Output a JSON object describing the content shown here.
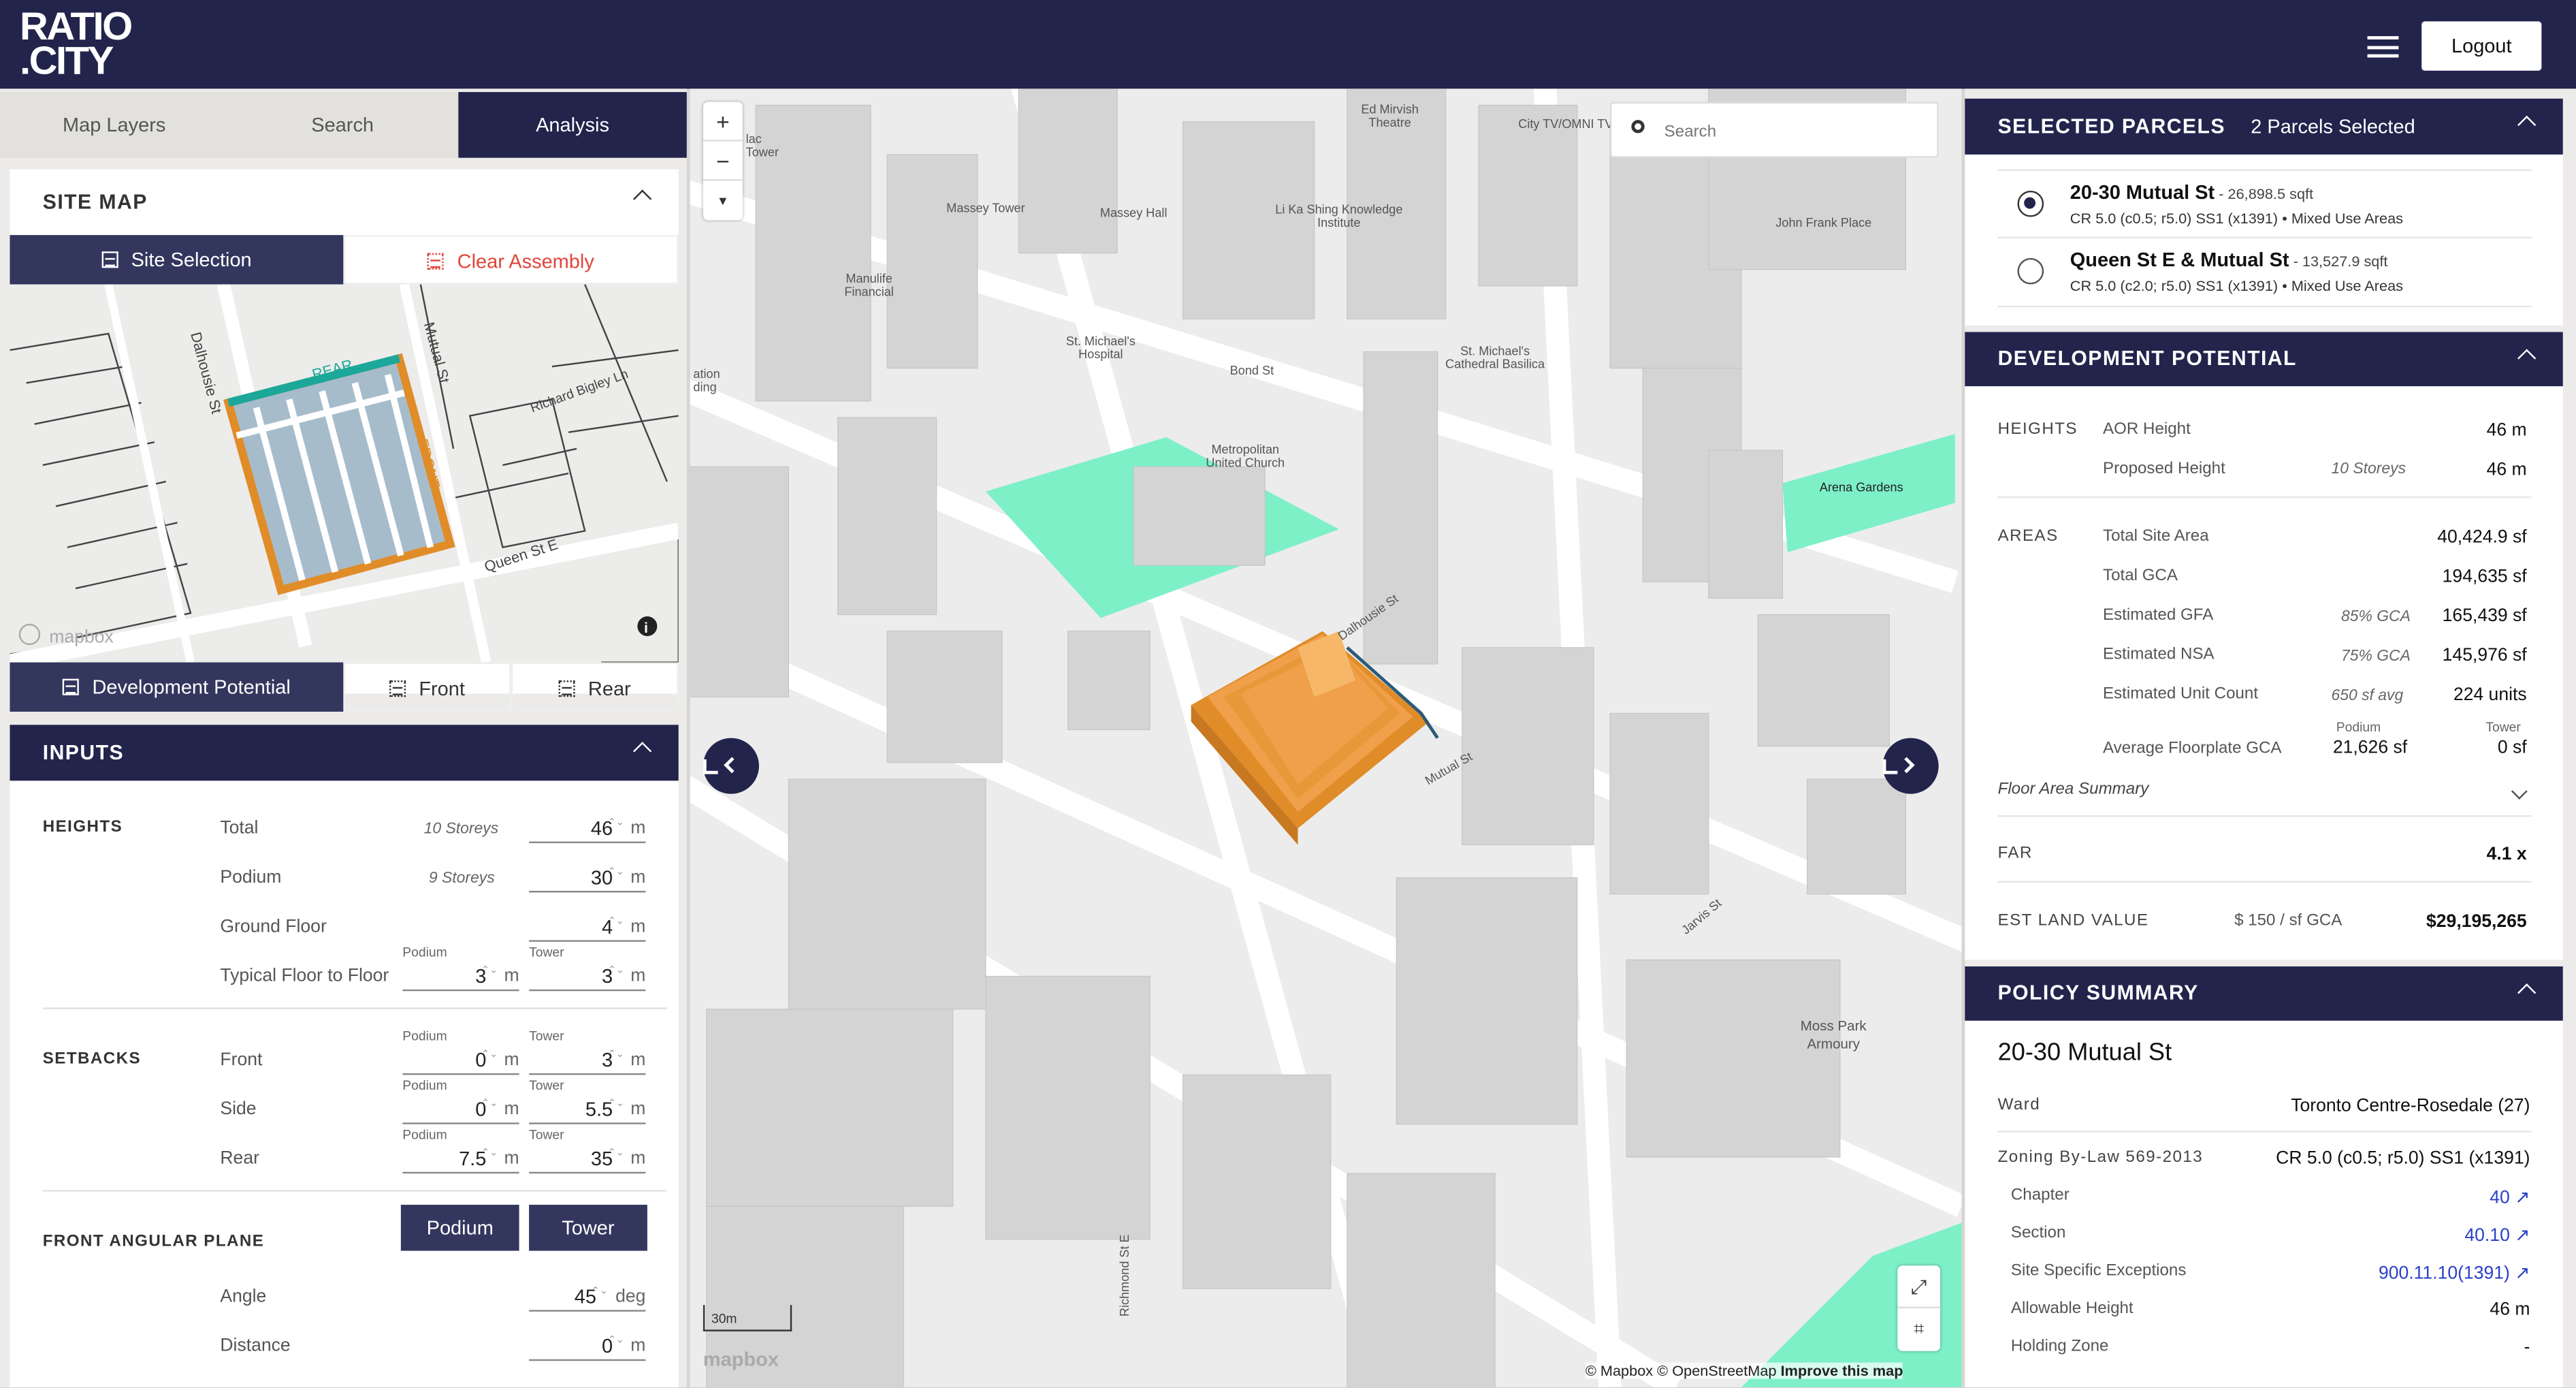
{
  "header": {
    "logo_line1": "RATIO",
    "logo_line2": ".CITY",
    "logout": "Logout",
    "menu_icon": "hamburger-icon"
  },
  "left_tabs": [
    "Map Layers",
    "Search",
    "Analysis"
  ],
  "site_map": {
    "title": "SITE MAP",
    "site_selection": "Site Selection",
    "clear_assembly": "Clear Assembly",
    "labels": {
      "rear": "REAR",
      "front": "FRONT",
      "dalhousie": "Dalhousie St",
      "mutual": "Mutual St",
      "richard": "Richard Bigley Ln",
      "queen": "Queen St E",
      "mapbox": "mapbox"
    },
    "dev_potential": "Development Potential",
    "front": "Front",
    "rear": "Rear"
  },
  "inputs": {
    "title": "INPUTS",
    "heights": {
      "label": "HEIGHTS",
      "total": "Total",
      "total_storeys": "10 Storeys",
      "total_val": "46",
      "podium": "Podium",
      "podium_storeys": "9 Storeys",
      "podium_val": "30",
      "ground": "Ground Floor",
      "ground_val": "4",
      "typical": "Typical Floor to Floor",
      "typ_podium_lbl": "Podium",
      "typ_podium": "3",
      "typ_tower_lbl": "Tower",
      "typ_tower": "3"
    },
    "setbacks": {
      "label": "SETBACKS",
      "front": "Front",
      "side": "Side",
      "rear": "Rear",
      "podium_lbl": "Podium",
      "tower_lbl": "Tower",
      "front_p": "0",
      "front_t": "3",
      "side_p": "0",
      "side_t": "5.5",
      "rear_p": "7.5",
      "rear_t": "35"
    },
    "fap": {
      "label": "FRONT ANGULAR PLANE",
      "podium_btn": "Podium",
      "tower_btn": "Tower",
      "angle": "Angle",
      "angle_val": "45",
      "distance": "Distance",
      "distance_val": "0"
    },
    "unit_m": "m",
    "unit_deg": "deg"
  },
  "map": {
    "search_placeholder": "Search",
    "scale": "30m",
    "attribution": "© Mapbox © OpenStreetMap",
    "improve": "Improve this map",
    "mapbox": "mapbox",
    "labels": [
      "Ed Mirvish Theatre",
      "City TV/OMNI TV",
      "Massey Tower",
      "Massey Hall",
      "Li Ka Shing Knowledge Institute",
      "John Frank Place",
      "Manulife Financial",
      "St. Michael's Hospital",
      "Bond St",
      "St. Michael's Cathedral Basilica",
      "Metropolitan United Church",
      "Arena Gardens",
      "Dalhousie St",
      "Mutual St",
      "Jarvis St",
      "Moss Park Armoury",
      "Richmond St E",
      "lac Tower",
      "ation ding"
    ]
  },
  "selected_parcels": {
    "title": "SELECTED PARCELS",
    "count": "2 Parcels Selected",
    "items": [
      {
        "name": "20-30 Mutual St",
        "area": " - 26,898.5 sqft",
        "zoning": "CR 5.0 (c0.5; r5.0) SS1 (x1391) • Mixed Use Areas",
        "selected": true
      },
      {
        "name": "Queen St E & Mutual St",
        "area": " - 13,527.9 sqft",
        "zoning": "CR 5.0 (c2.0; r5.0) SS1 (x1391) • Mixed Use Areas",
        "selected": false
      }
    ]
  },
  "dev": {
    "title": "DEVELOPMENT POTENTIAL",
    "heights": "HEIGHTS",
    "aor": "AOR Height",
    "aor_v": "46 m",
    "proposed": "Proposed Height",
    "proposed_s": "10 Storeys",
    "proposed_v": "46 m",
    "areas": "AREAS",
    "tsa": "Total Site Area",
    "tsa_v": "40,424.9 sf",
    "gca": "Total GCA",
    "gca_v": "194,635 sf",
    "gfa": "Estimated GFA",
    "gfa_p": "85% GCA",
    "gfa_v": "165,439 sf",
    "nsa": "Estimated NSA",
    "nsa_p": "75% GCA",
    "nsa_v": "145,976 sf",
    "units": "Estimated Unit Count",
    "units_p": "650 sf avg",
    "units_v": "224 units",
    "afp": "Average Floorplate GCA",
    "podium": "Podium",
    "tower": "Tower",
    "afp_p": "21,626 sf",
    "afp_t": "0 sf",
    "fas": "Floor Area Summary",
    "far": "FAR",
    "far_v": "4.1 x",
    "elv": "EST LAND VALUE",
    "elv_rate": "$ 150 / sf GCA",
    "elv_v": "$29,195,265"
  },
  "policy": {
    "title": "POLICY SUMMARY",
    "name": "20-30 Mutual St",
    "ward": "Ward",
    "ward_v": "Toronto Centre-Rosedale (27)",
    "zbl": "Zoning By-Law 569-2013",
    "zbl_v": "CR 5.0 (c0.5; r5.0) SS1 (x1391)",
    "chapter": "Chapter",
    "chapter_v": "40",
    "section": "Section",
    "section_v": "40.10",
    "sse": "Site Specific Exceptions",
    "sse_v": "900.11.10(1391)",
    "ah": "Allowable Height",
    "ah_v": "46 m",
    "hz": "Holding Zone",
    "hz_v": "-"
  },
  "colors": {
    "navy": "#22244c",
    "park": "#7df0c8",
    "building": "#f0a04a",
    "clear": "#e0453a"
  }
}
